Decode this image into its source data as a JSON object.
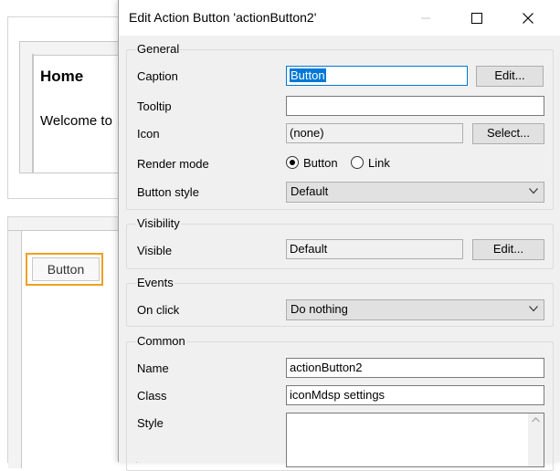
{
  "background": {
    "home_title": "Home",
    "welcome_text": "Welcome to",
    "button_caption": "Button"
  },
  "dialog": {
    "title": "Edit Action Button 'actionButton2'",
    "general": {
      "title": "General",
      "caption_label": "Caption",
      "caption_value": "Button",
      "caption_edit": "Edit...",
      "tooltip_label": "Tooltip",
      "tooltip_value": "",
      "icon_label": "Icon",
      "icon_value": "(none)",
      "icon_select": "Select...",
      "render_mode_label": "Render mode",
      "render_mode_options": [
        "Button",
        "Link"
      ],
      "render_mode_selected": "Button",
      "button_style_label": "Button style",
      "button_style_value": "Default"
    },
    "visibility": {
      "title": "Visibility",
      "visible_label": "Visible",
      "visible_value": "Default",
      "visible_edit": "Edit..."
    },
    "events": {
      "title": "Events",
      "on_click_label": "On click",
      "on_click_value": "Do nothing"
    },
    "common": {
      "title": "Common",
      "name_label": "Name",
      "name_value": "actionButton2",
      "class_label": "Class",
      "class_value": "iconMdsp settings",
      "style_label": "Style",
      "style_value": ""
    }
  },
  "colors": {
    "selection_outline": "#f0a020",
    "focus_accent": "#0078d7",
    "dialog_bg": "#f0f0f0"
  }
}
